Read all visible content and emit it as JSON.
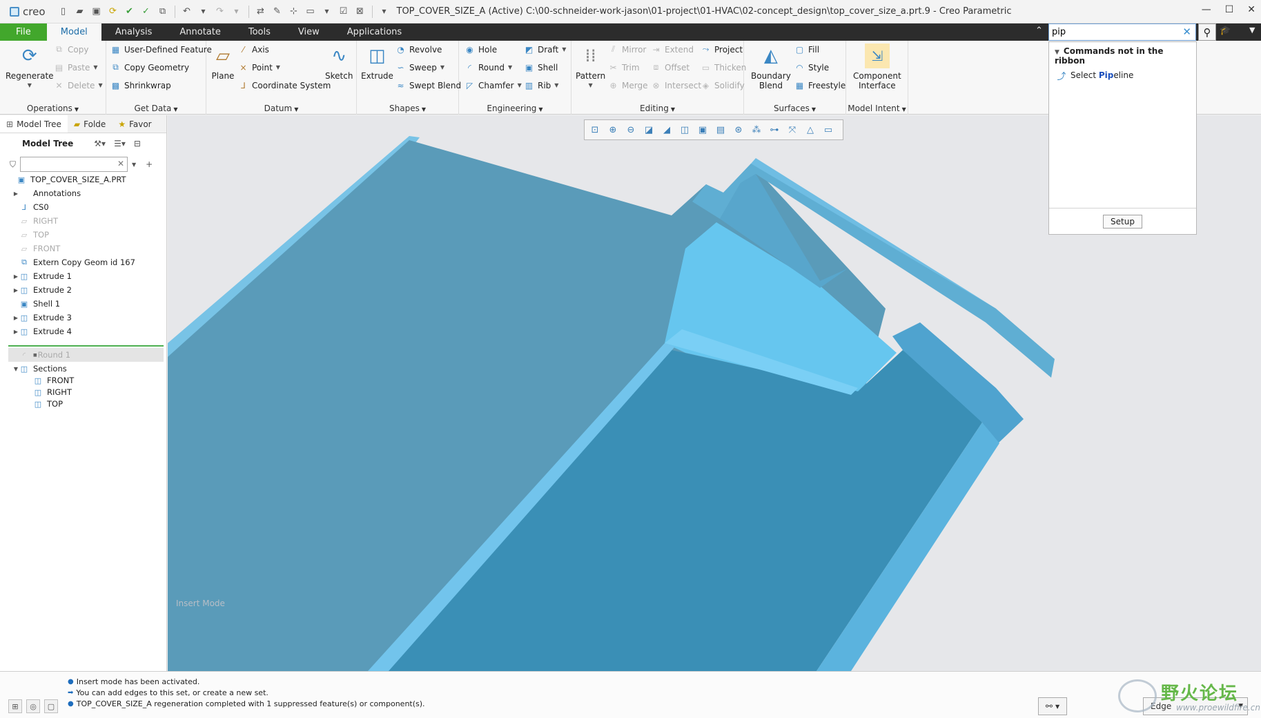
{
  "window": {
    "app_logo": "creo",
    "title": "TOP_COVER_SIZE_A (Active) C:\\00-schneider-work-jason\\01-project\\01-HVAC\\02-concept_design\\top_cover_size_a.prt.9 - Creo Parametric"
  },
  "tabs": [
    {
      "label": "File"
    },
    {
      "label": "Model"
    },
    {
      "label": "Analysis"
    },
    {
      "label": "Annotate"
    },
    {
      "label": "Tools"
    },
    {
      "label": "View"
    },
    {
      "label": "Applications"
    }
  ],
  "command_search": {
    "value": "pip",
    "placeholder": ""
  },
  "ribbon": {
    "operations": {
      "label": "Operations",
      "regenerate": "Regenerate",
      "copy": "Copy",
      "paste": "Paste",
      "delete": "Delete"
    },
    "get_data": {
      "label": "Get Data",
      "udf": "User-Defined Feature",
      "copy_geometry": "Copy Geometry",
      "shrinkwrap": "Shrinkwrap"
    },
    "datum": {
      "label": "Datum",
      "plane": "Plane",
      "axis": "Axis",
      "point": "Point",
      "csys": "Coordinate System",
      "sketch": "Sketch"
    },
    "shapes": {
      "label": "Shapes",
      "extrude": "Extrude",
      "revolve": "Revolve",
      "sweep": "Sweep",
      "swept_blend": "Swept Blend"
    },
    "engineering": {
      "label": "Engineering",
      "hole": "Hole",
      "round": "Round",
      "chamfer": "Chamfer",
      "draft": "Draft",
      "shell": "Shell",
      "rib": "Rib"
    },
    "editing": {
      "label": "Editing",
      "pattern": "Pattern",
      "mirror": "Mirror",
      "trim": "Trim",
      "merge": "Merge",
      "extend": "Extend",
      "offset": "Offset",
      "intersect": "Intersect",
      "project": "Project",
      "thicken": "Thicken",
      "solidify": "Solidify"
    },
    "surfaces": {
      "label": "Surfaces",
      "boundary_blend_1": "Boundary",
      "boundary_blend_2": "Blend",
      "fill": "Fill",
      "style": "Style",
      "freestyle": "Freestyle"
    },
    "model_intent": {
      "label": "Model Intent",
      "component_interface_1": "Component",
      "component_interface_2": "Interface"
    }
  },
  "search_results": {
    "header": "Commands not in the ribbon",
    "item_prefix": "Select ",
    "item_match": "Pip",
    "item_suffix": "eline",
    "setup": "Setup"
  },
  "panel_tabs": [
    "Model Tree",
    "Folde",
    "Favor"
  ],
  "model_tree": {
    "header": "Model Tree",
    "items": [
      {
        "label": "TOP_COVER_SIZE_A.PRT",
        "icon": "part-icon",
        "indent": 0,
        "expand": "",
        "dim": false
      },
      {
        "label": "Annotations",
        "icon": "",
        "indent": 1,
        "expand": "▶",
        "dim": false
      },
      {
        "label": "CS0",
        "icon": "csys-icon",
        "indent": 1,
        "expand": "",
        "dim": false
      },
      {
        "label": "RIGHT",
        "icon": "plane-icon",
        "indent": 1,
        "expand": "",
        "dim": true
      },
      {
        "label": "TOP",
        "icon": "plane-icon",
        "indent": 1,
        "expand": "",
        "dim": true
      },
      {
        "label": "FRONT",
        "icon": "plane-icon",
        "indent": 1,
        "expand": "",
        "dim": true
      },
      {
        "label": "Extern Copy Geom id 167",
        "icon": "copy-geom-icon",
        "indent": 1,
        "expand": "",
        "dim": false
      },
      {
        "label": "Extrude 1",
        "icon": "extrude-icon",
        "indent": 1,
        "expand": "▶",
        "dim": false
      },
      {
        "label": "Extrude 2",
        "icon": "extrude-icon",
        "indent": 1,
        "expand": "▶",
        "dim": false
      },
      {
        "label": "Shell 1",
        "icon": "shell-icon",
        "indent": 1,
        "expand": "",
        "dim": false
      },
      {
        "label": "Extrude 3",
        "icon": "extrude-icon",
        "indent": 1,
        "expand": "▶",
        "dim": false
      },
      {
        "label": "Extrude 4",
        "icon": "extrude-icon",
        "indent": 1,
        "expand": "▶",
        "dim": false
      }
    ],
    "suppressed": {
      "label": "Round 1",
      "marker": "■",
      "icon": "round-icon"
    },
    "after": [
      {
        "label": "Sections",
        "icon": "section-icon",
        "indent": 1,
        "expand": "▼",
        "dim": false
      },
      {
        "label": "FRONT",
        "icon": "section-icon",
        "indent": 2,
        "expand": "",
        "dim": false
      },
      {
        "label": "RIGHT",
        "icon": "section-icon",
        "indent": 2,
        "expand": "",
        "dim": false
      },
      {
        "label": "TOP",
        "icon": "section-icon",
        "indent": 2,
        "expand": "",
        "dim": false
      }
    ]
  },
  "viewport": {
    "mode_text": "Insert Mode"
  },
  "messages": [
    {
      "bullet": "●",
      "text": "Insert mode has been activated."
    },
    {
      "bullet": "➡",
      "text": "You can add edges to this set, or create a new set."
    },
    {
      "bullet": "●",
      "text": "TOP_COVER_SIZE_A regeneration completed with 1 suppressed feature(s) or component(s)."
    }
  ],
  "selection_filter": "Edge",
  "watermark": {
    "title": "野火论坛",
    "url": "www.proewildfire.cn"
  },
  "colors": {
    "accent": "#1c6da8",
    "file_tab": "#42a72c",
    "model_face": "#5b9bb8",
    "model_light": "#66c6ef",
    "model_dark": "#3a8fb5"
  }
}
